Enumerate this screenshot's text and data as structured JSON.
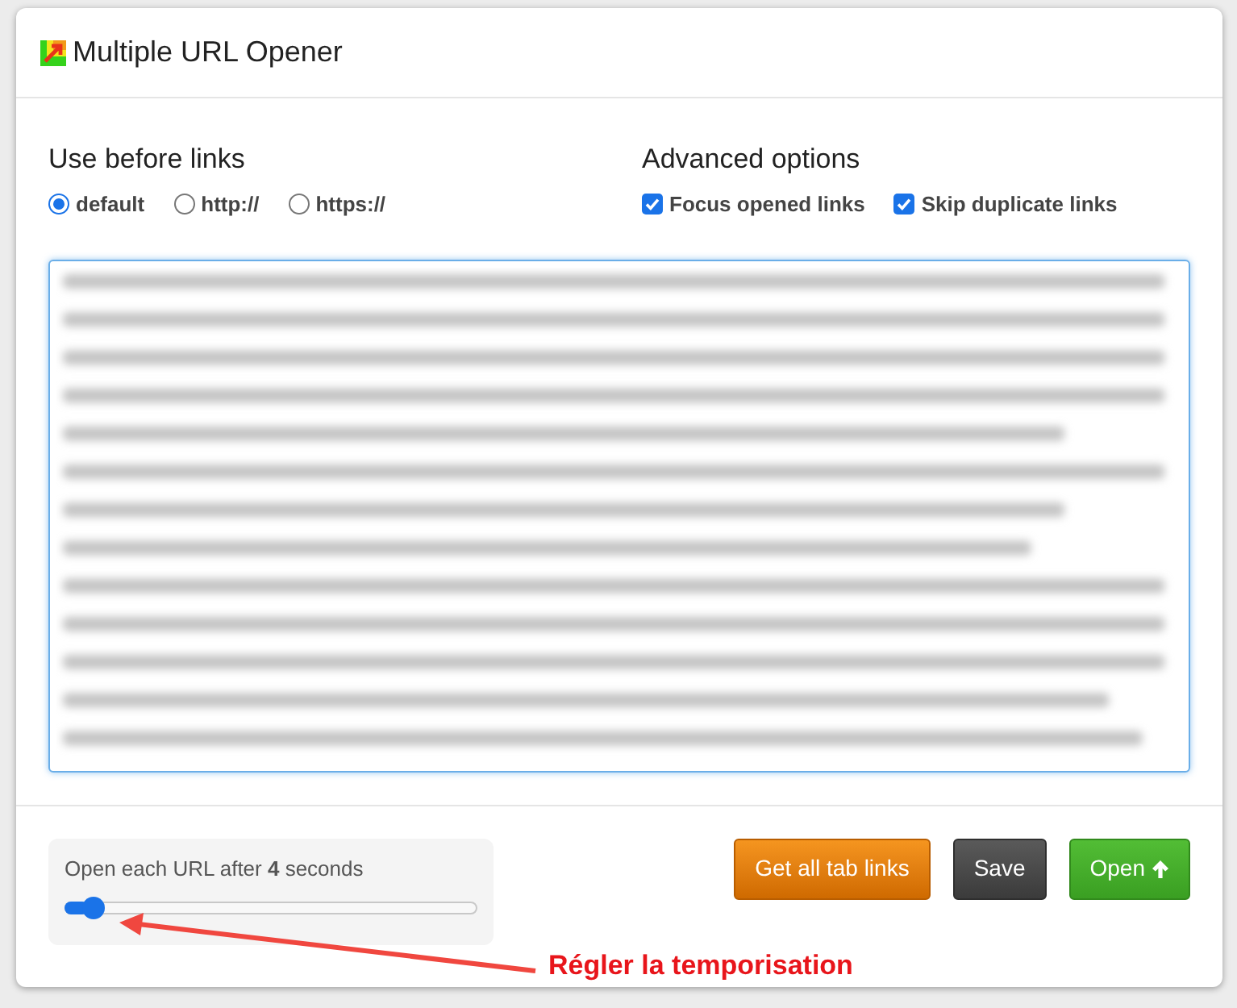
{
  "window": {
    "title": "Multiple URL Opener"
  },
  "prefix": {
    "title": "Use before links",
    "options": [
      {
        "label": "default",
        "selected": true
      },
      {
        "label": "http://",
        "selected": false
      },
      {
        "label": "https://",
        "selected": false
      }
    ]
  },
  "advanced": {
    "title": "Advanced options",
    "options": [
      {
        "label": "Focus opened links",
        "checked": true
      },
      {
        "label": "Skip duplicate links",
        "checked": true
      }
    ]
  },
  "links_field": {
    "focused": true
  },
  "delay": {
    "label": "Open each URL after **4** seconds",
    "level": 0.06
  },
  "buttons": [
    {
      "label": "Get all tab links",
      "kind": "warning"
    },
    {
      "label": "Save",
      "kind": "dark"
    },
    {
      "label": "Open",
      "kind": "success"
    }
  ],
  "annotation": {
    "text": "Régler la temporisation"
  }
}
